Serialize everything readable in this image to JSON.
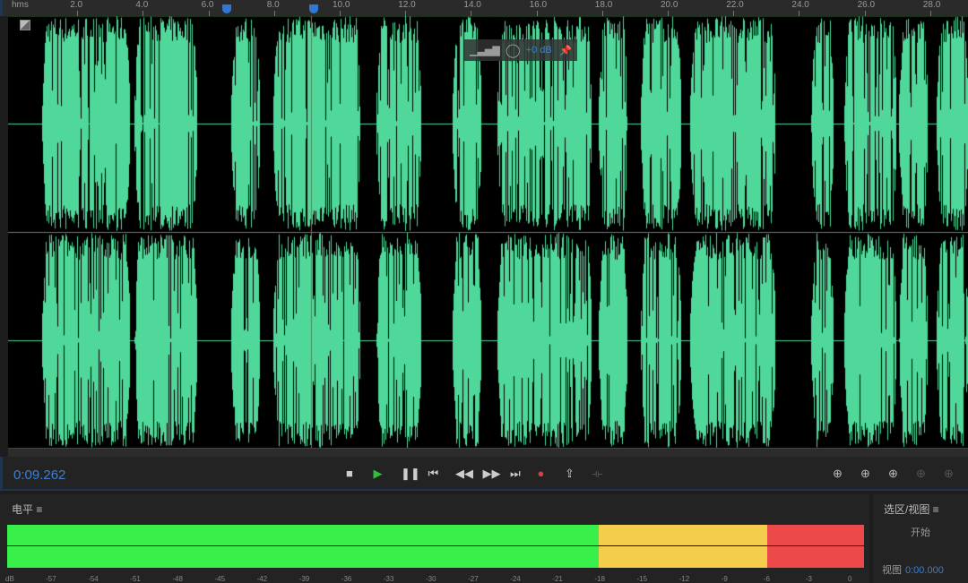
{
  "ruler": {
    "unit": "hms",
    "labels": [
      "2.0",
      "4.0",
      "6.0",
      "8.0",
      "10.0",
      "12.0",
      "14.0",
      "16.0",
      "18.0",
      "20.0",
      "22.0",
      "24.0",
      "26.0",
      "28.0"
    ]
  },
  "waveform": {
    "color": "#4fd89a",
    "channels": 2,
    "gain_hud": {
      "value": "+0 dB"
    }
  },
  "transport": {
    "current_time": "0:09.262",
    "buttons": [
      {
        "name": "stop-button",
        "icon": "■"
      },
      {
        "name": "play-button",
        "icon": "▶"
      },
      {
        "name": "pause-button",
        "icon": "❚❚"
      },
      {
        "name": "go-to-start-button",
        "icon": "⏮"
      },
      {
        "name": "rewind-button",
        "icon": "◀◀"
      },
      {
        "name": "fast-forward-button",
        "icon": "▶▶"
      },
      {
        "name": "go-to-end-button",
        "icon": "⏭"
      },
      {
        "name": "record-button",
        "icon": "●"
      },
      {
        "name": "loop-button",
        "icon": "⇪"
      },
      {
        "name": "skip-selection-button",
        "icon": "⟛"
      }
    ],
    "zoom_buttons": [
      "zoom-in-amplitude",
      "zoom-out-amplitude",
      "zoom-in-time",
      "zoom-out-time",
      "zoom-full"
    ]
  },
  "levels": {
    "title": "电平",
    "unit": "dB",
    "scale": [
      "-57",
      "-54",
      "-51",
      "-48",
      "-45",
      "-42",
      "-39",
      "-36",
      "-33",
      "-30",
      "-27",
      "-24",
      "-21",
      "-18",
      "-15",
      "-12",
      "-9",
      "-6",
      "-3",
      "0"
    ],
    "colors": {
      "green": "#39ef4a",
      "yellow": "#f3cd4b",
      "red": "#ec4a4a"
    }
  },
  "selection_view": {
    "title": "选区/视图",
    "start_label": "开始",
    "view_label": "视图",
    "view_value": "0:00.000"
  }
}
